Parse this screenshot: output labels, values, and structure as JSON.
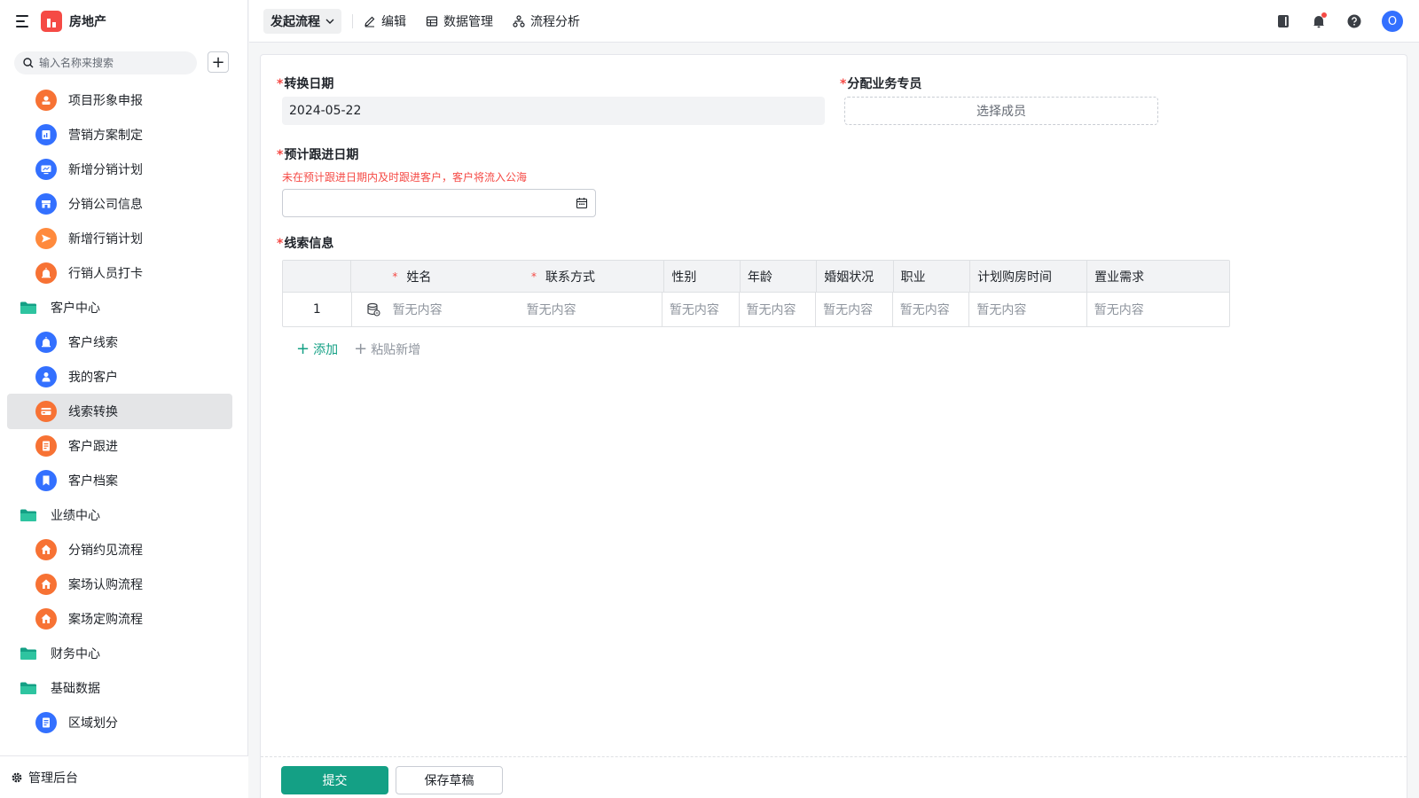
{
  "app": {
    "name": "房地产",
    "brand_color": "#f54a45"
  },
  "search": {
    "placeholder": "输入名称来搜索"
  },
  "sidebar": {
    "items": [
      {
        "label": "项目形象申报",
        "icon": "user-card-icon"
      },
      {
        "label": "营销方案制定",
        "icon": "chart-sheet-icon"
      },
      {
        "label": "新增分销计划",
        "icon": "monitor-icon"
      },
      {
        "label": "分销公司信息",
        "icon": "store-icon"
      },
      {
        "label": "新增行销计划",
        "icon": "send-icon"
      },
      {
        "label": "行销人员打卡",
        "icon": "alarm-icon"
      },
      {
        "label": "客户中心",
        "icon": "folder-icon"
      },
      {
        "label": "客户线索",
        "icon": "alarm-icon"
      },
      {
        "label": "我的客户",
        "icon": "person-icon"
      },
      {
        "label": "线索转换",
        "icon": "card-icon"
      },
      {
        "label": "客户跟进",
        "icon": "doc-icon"
      },
      {
        "label": "客户档案",
        "icon": "bookmark-icon"
      },
      {
        "label": "业绩中心",
        "icon": "folder-icon"
      },
      {
        "label": "分销约见流程",
        "icon": "home-icon"
      },
      {
        "label": "案场认购流程",
        "icon": "home-icon"
      },
      {
        "label": "案场定购流程",
        "icon": "home-icon"
      },
      {
        "label": "财务中心",
        "icon": "folder-icon"
      },
      {
        "label": "基础数据",
        "icon": "folder-icon"
      },
      {
        "label": "区域划分",
        "icon": "doc-icon"
      }
    ],
    "footer_label": "管理后台"
  },
  "toolbar": {
    "launch_label": "发起流程",
    "edit_label": "编辑",
    "data_label": "数据管理",
    "analysis_label": "流程分析",
    "avatar_letter": "O"
  },
  "form": {
    "convert_date_label": "转换日期",
    "convert_date_value": "2024-05-22",
    "assign_label": "分配业务专员",
    "assign_placeholder": "选择成员",
    "follow_date_label": "预计跟进日期",
    "follow_hint": "未在预计跟进日期内及时跟进客户，客户将流入公海",
    "leads_label": "线索信息",
    "required_mark": "*"
  },
  "table": {
    "headers": [
      "姓名",
      "联系方式",
      "性别",
      "年龄",
      "婚姻状况",
      "职业",
      "计划购房时间",
      "置业需求"
    ],
    "row_index": "1",
    "empty": "暂无内容",
    "add_label": "添加",
    "paste_label": "粘贴新增"
  },
  "actions": {
    "submit_label": "提交",
    "draft_label": "保存草稿"
  },
  "colors": {
    "primary": "#14a085",
    "danger": "#f54a45",
    "blue": "#3370ff",
    "orange": "#f77234"
  }
}
